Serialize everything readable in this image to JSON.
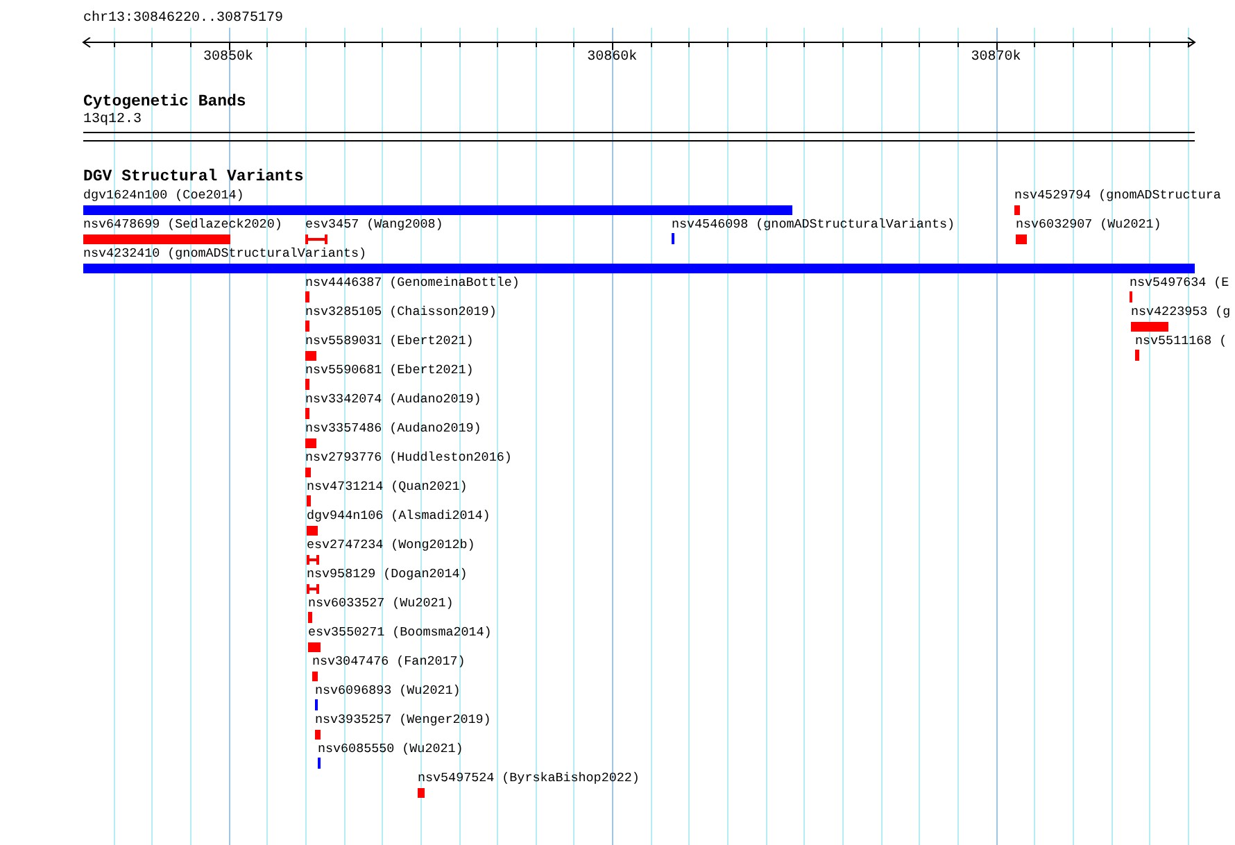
{
  "location": "chr13:30846220..30875179",
  "ruler": {
    "ticks": [
      {
        "label": "30850k"
      },
      {
        "label": "30860k"
      },
      {
        "label": "30870k"
      }
    ]
  },
  "cytobands": {
    "title": "Cytogenetic Bands",
    "band": "13q12.3"
  },
  "dgv": {
    "title": "DGV Structural Variants",
    "rows": [
      {
        "features": [
          {
            "label": "dgv1624n100 (Coe2014)",
            "kind": "bar",
            "color": "#0000ff"
          },
          {
            "label": "nsv4529794 (gnomADStructura",
            "kind": "bar",
            "color": "#ff0000"
          }
        ]
      },
      {
        "features": [
          {
            "label": "nsv6478699 (Sedlazeck2020)",
            "kind": "bar",
            "color": "#ff0000"
          },
          {
            "label": "esv3457 (Wang2008)",
            "kind": "bracket",
            "color": "#ff0000"
          },
          {
            "label": "nsv4546098 (gnomADStructuralVariants)",
            "kind": "bar",
            "color": "#0000ff"
          },
          {
            "label": "nsv6032907 (Wu2021)",
            "kind": "bar",
            "color": "#ff0000"
          }
        ]
      },
      {
        "features": [
          {
            "label": "nsv4232410 (gnomADStructuralVariants)",
            "kind": "bar",
            "color": "#0000ff"
          }
        ]
      },
      {
        "features": [
          {
            "label": "nsv4446387 (GenomeinaBottle)",
            "kind": "bar",
            "color": "#ff0000"
          },
          {
            "label": "nsv5497634 (E",
            "kind": "bar",
            "color": "#ff0000"
          }
        ]
      },
      {
        "features": [
          {
            "label": "nsv3285105 (Chaisson2019)",
            "kind": "bar",
            "color": "#ff0000"
          },
          {
            "label": "nsv4223953 (g",
            "kind": "bar",
            "color": "#ff0000"
          }
        ]
      },
      {
        "features": [
          {
            "label": "nsv5589031 (Ebert2021)",
            "kind": "bar",
            "color": "#ff0000"
          },
          {
            "label": "nsv5511168 (",
            "kind": "bar",
            "color": "#ff0000"
          }
        ]
      },
      {
        "features": [
          {
            "label": "nsv5590681 (Ebert2021)",
            "kind": "bar",
            "color": "#ff0000"
          }
        ]
      },
      {
        "features": [
          {
            "label": "nsv3342074 (Audano2019)",
            "kind": "bar",
            "color": "#ff0000"
          }
        ]
      },
      {
        "features": [
          {
            "label": "nsv3357486 (Audano2019)",
            "kind": "bar",
            "color": "#ff0000"
          }
        ]
      },
      {
        "features": [
          {
            "label": "nsv2793776 (Huddleston2016)",
            "kind": "bar",
            "color": "#ff0000"
          }
        ]
      },
      {
        "features": [
          {
            "label": "nsv4731214 (Quan2021)",
            "kind": "bar",
            "color": "#ff0000"
          }
        ]
      },
      {
        "features": [
          {
            "label": "dgv944n106 (Alsmadi2014)",
            "kind": "bar",
            "color": "#ff0000"
          }
        ]
      },
      {
        "features": [
          {
            "label": "esv2747234 (Wong2012b)",
            "kind": "bracket",
            "color": "#ff0000"
          }
        ]
      },
      {
        "features": [
          {
            "label": "nsv958129 (Dogan2014)",
            "kind": "bracket",
            "color": "#ff0000"
          }
        ]
      },
      {
        "features": [
          {
            "label": "nsv6033527 (Wu2021)",
            "kind": "bar",
            "color": "#ff0000"
          }
        ]
      },
      {
        "features": [
          {
            "label": "esv3550271 (Boomsma2014)",
            "kind": "bar",
            "color": "#ff0000"
          }
        ]
      },
      {
        "features": [
          {
            "label": "nsv3047476 (Fan2017)",
            "kind": "bar",
            "color": "#ff0000"
          }
        ]
      },
      {
        "features": [
          {
            "label": "nsv6096893 (Wu2021)",
            "kind": "bar",
            "color": "#0000ff"
          }
        ]
      },
      {
        "features": [
          {
            "label": "nsv3935257 (Wenger2019)",
            "kind": "bar",
            "color": "#ff0000"
          }
        ]
      },
      {
        "features": [
          {
            "label": "nsv6085550 (Wu2021)",
            "kind": "bar",
            "color": "#0000ff"
          }
        ]
      },
      {
        "features": [
          {
            "label": "nsv5497524 (ByrskaBishop2022)",
            "kind": "bar",
            "color": "#ff0000"
          }
        ]
      }
    ]
  }
}
